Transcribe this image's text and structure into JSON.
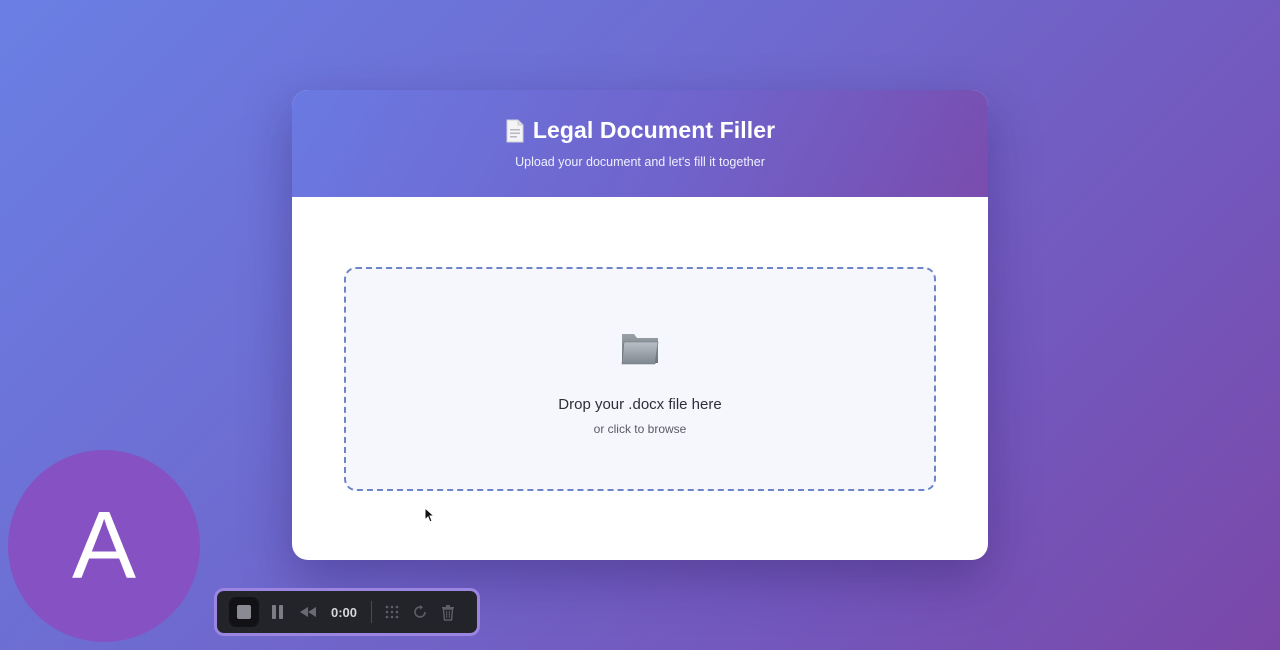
{
  "header": {
    "icon": "document-icon",
    "title": "Legal Document Filler",
    "subtitle": "Upload your document and let's fill it together"
  },
  "dropzone": {
    "icon": "folder-icon",
    "title": "Drop your .docx file here",
    "hint": "or click to browse"
  },
  "avatar": {
    "initial": "A"
  },
  "recorder": {
    "time": "0:00",
    "buttons": [
      "stop-icon",
      "pause-icon",
      "rewind-icon",
      "grid-icon",
      "restart-icon",
      "trash-icon"
    ]
  },
  "colors": {
    "background_start": "#6a7fe4",
    "background_end": "#7a48a8",
    "dropzone_border": "#6d84c9",
    "dropzone_fill": "#f5f7fd",
    "avatar": "#8651c3",
    "recorder_border": "#9a86e0"
  }
}
